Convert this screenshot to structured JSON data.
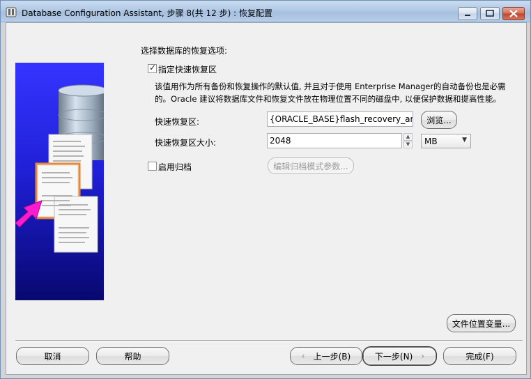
{
  "window": {
    "title": "Database Configuration Assistant, 步骤 8(共 12 步) : 恢复配置"
  },
  "main": {
    "section_label": "选择数据库的恢复选项:",
    "fast_recovery": {
      "checkbox_label": "指定快速恢复区",
      "checked": true,
      "description_line1": "该值用作为所有备份和恢复操作的默认值, 并且对于使用 Enterprise Manager的自动备份也是必需",
      "description_line2": "的。Oracle 建议将数据库文件和恢复文件放在物理位置不同的磁盘中, 以便保护数据和提高性能。",
      "area_label": "快速恢复区:",
      "area_value": "{ORACLE_BASE}flash_recovery_area",
      "browse_label": "浏览...",
      "size_label": "快速恢复区大小:",
      "size_value": "2048",
      "unit_value": "MB"
    },
    "archive": {
      "checkbox_label": "启用归档",
      "checked": false,
      "edit_params_label": "编辑归档模式参数..."
    },
    "file_location_vars_label": "文件位置变量..."
  },
  "footer": {
    "cancel_label": "取消",
    "help_label": "帮助",
    "back_label": "上一步(B)",
    "next_label": "下一步(N)",
    "finish_label": "完成(F)"
  },
  "side_image": {
    "doc_text": "Nnnm&Ndbrnnam"
  }
}
